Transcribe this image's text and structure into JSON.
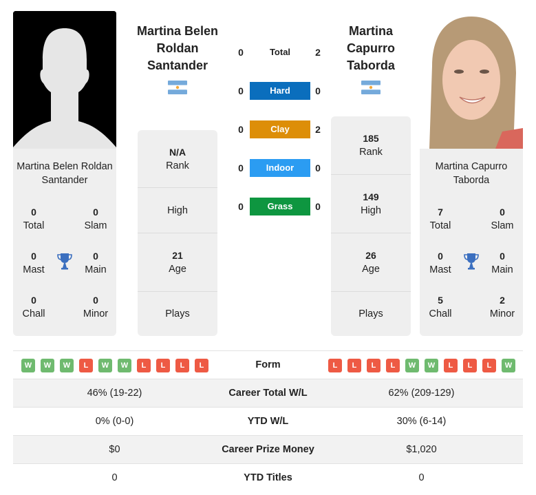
{
  "colors": {
    "hard": "#0a6ebd",
    "clay": "#dd8e08",
    "indoor": "#2b9cf2",
    "grass": "#0e9640",
    "win": "#6fba6f",
    "loss": "#ee5a44",
    "trophy": "#3b6fbf"
  },
  "left": {
    "name_title": [
      "Martina Belen",
      "Roldan",
      "Santander"
    ],
    "name_card": "Martina Belen Roldan Santander",
    "photo": "silhouette-placeholder",
    "flag": "argentina-flag",
    "titles": {
      "total": {
        "value": "0",
        "label": "Total"
      },
      "slam": {
        "value": "0",
        "label": "Slam"
      },
      "mast": {
        "value": "0",
        "label": "Mast"
      },
      "main": {
        "value": "0",
        "label": "Main"
      },
      "chall": {
        "value": "0",
        "label": "Chall"
      },
      "minor": {
        "value": "0",
        "label": "Minor"
      }
    },
    "info": {
      "rank": {
        "value": "N/A",
        "label": "Rank"
      },
      "high": {
        "value": "",
        "label": "High"
      },
      "age": {
        "value": "21",
        "label": "Age"
      },
      "plays": {
        "value": "",
        "label": "Plays"
      }
    },
    "form": [
      "W",
      "W",
      "W",
      "L",
      "W",
      "W",
      "L",
      "L",
      "L",
      "L"
    ]
  },
  "right": {
    "name_title": [
      "Martina",
      "Capurro",
      "Taborda"
    ],
    "name_card": "Martina Capurro Taborda",
    "photo": "player-photo",
    "flag": "argentina-flag",
    "titles": {
      "total": {
        "value": "7",
        "label": "Total"
      },
      "slam": {
        "value": "0",
        "label": "Slam"
      },
      "mast": {
        "value": "0",
        "label": "Mast"
      },
      "main": {
        "value": "0",
        "label": "Main"
      },
      "chall": {
        "value": "5",
        "label": "Chall"
      },
      "minor": {
        "value": "2",
        "label": "Minor"
      }
    },
    "info": {
      "rank": {
        "value": "185",
        "label": "Rank"
      },
      "high": {
        "value": "149",
        "label": "High"
      },
      "age": {
        "value": "26",
        "label": "Age"
      },
      "plays": {
        "value": "",
        "label": "Plays"
      }
    },
    "form": [
      "L",
      "L",
      "L",
      "L",
      "W",
      "W",
      "L",
      "L",
      "L",
      "W"
    ]
  },
  "h2h": [
    {
      "label": "Total",
      "left": "0",
      "right": "2",
      "surface": "none"
    },
    {
      "label": "Hard",
      "left": "0",
      "right": "0",
      "surface": "hard"
    },
    {
      "label": "Clay",
      "left": "0",
      "right": "2",
      "surface": "clay"
    },
    {
      "label": "Indoor",
      "left": "0",
      "right": "0",
      "surface": "indoor"
    },
    {
      "label": "Grass",
      "left": "0",
      "right": "0",
      "surface": "grass"
    }
  ],
  "comparison": {
    "form_label": "Form",
    "rows": [
      {
        "label": "Career Total W/L",
        "left": "46% (19-22)",
        "right": "62% (209-129)"
      },
      {
        "label": "YTD W/L",
        "left": "0% (0-0)",
        "right": "30% (6-14)"
      },
      {
        "label": "Career Prize Money",
        "left": "$0",
        "right": "$1,020"
      },
      {
        "label": "YTD Titles",
        "left": "0",
        "right": "0"
      }
    ]
  }
}
